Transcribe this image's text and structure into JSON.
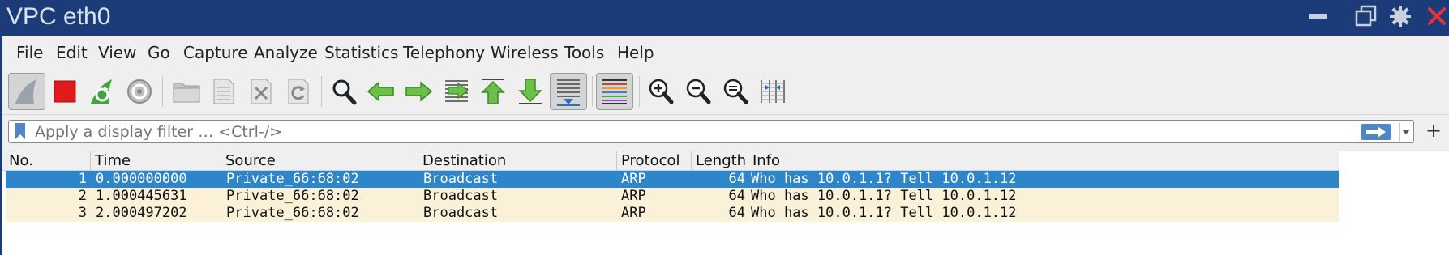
{
  "window": {
    "title": "VPC eth0"
  },
  "menu": [
    "File",
    "Edit",
    "View",
    "Go",
    "Capture",
    "Analyze",
    "Statistics",
    "Telephony",
    "Wireless",
    "Tools",
    "Help"
  ],
  "toolbar": [
    "start-capture-icon",
    "stop-capture-icon",
    "restart-capture-icon",
    "capture-options-icon",
    "open-file-icon",
    "save-file-icon",
    "close-file-icon",
    "reload-file-icon",
    "find-packet-icon",
    "go-back-icon",
    "go-forward-icon",
    "go-to-packet-icon",
    "go-first-icon",
    "go-last-icon",
    "autoscroll-icon",
    "colorize-icon",
    "zoom-in-icon",
    "zoom-out-icon",
    "normal-size-icon",
    "resize-columns-icon"
  ],
  "filter": {
    "placeholder": "Apply a display filter … <Ctrl-/>",
    "add_label": "+"
  },
  "packets": {
    "columns": [
      "No.",
      "Time",
      "Source",
      "Destination",
      "Protocol",
      "Length",
      "Info"
    ],
    "rows": [
      {
        "no": "1",
        "time": "0.000000000",
        "source": "Private_66:68:02",
        "destination": "Broadcast",
        "protocol": "ARP",
        "length": "64",
        "info": "Who has 10.0.1.1? Tell 10.0.1.12"
      },
      {
        "no": "2",
        "time": "1.000445631",
        "source": "Private_66:68:02",
        "destination": "Broadcast",
        "protocol": "ARP",
        "length": "64",
        "info": "Who has 10.0.1.1? Tell 10.0.1.12"
      },
      {
        "no": "3",
        "time": "2.000497202",
        "source": "Private_66:68:02",
        "destination": "Broadcast",
        "protocol": "ARP",
        "length": "64",
        "info": "Who has 10.0.1.1? Tell 10.0.1.12"
      }
    ]
  },
  "colors": {
    "titlebar": "#1b3c78",
    "selected_row": "#2e85c7",
    "arp_row": "#fbf1d8"
  }
}
